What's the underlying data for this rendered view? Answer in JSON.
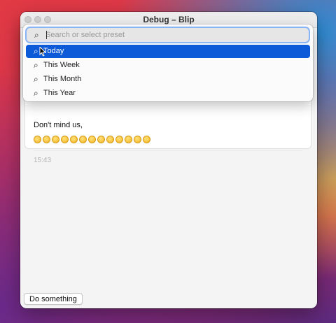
{
  "window": {
    "title": "Debug – Blip"
  },
  "search": {
    "placeholder": "Search or select preset",
    "value": ""
  },
  "presets": [
    {
      "label": "Today",
      "selected": true
    },
    {
      "label": "This Week",
      "selected": false
    },
    {
      "label": "This Month",
      "selected": false
    },
    {
      "label": "This Year",
      "selected": false
    }
  ],
  "message": {
    "text": "Don't mind us,",
    "emojis": [
      "upside-down-face",
      "smiling-face-with-halo",
      "smiling-face-with-halo",
      "partying-face",
      "winking-face-with-tongue",
      "squinting-face-with-tongue",
      "zany-face",
      "grinning-face-with-sweat",
      "rolling-on-floor-laughing",
      "slightly-smiling-face",
      "grinning-face",
      "grinning-face-with-sweat",
      "grinning-face"
    ],
    "time": "15:43"
  },
  "footer": {
    "button_label": "Do something"
  },
  "colors": {
    "selection": "#0d5ad8",
    "focus_ring": "#8ab4f8"
  }
}
